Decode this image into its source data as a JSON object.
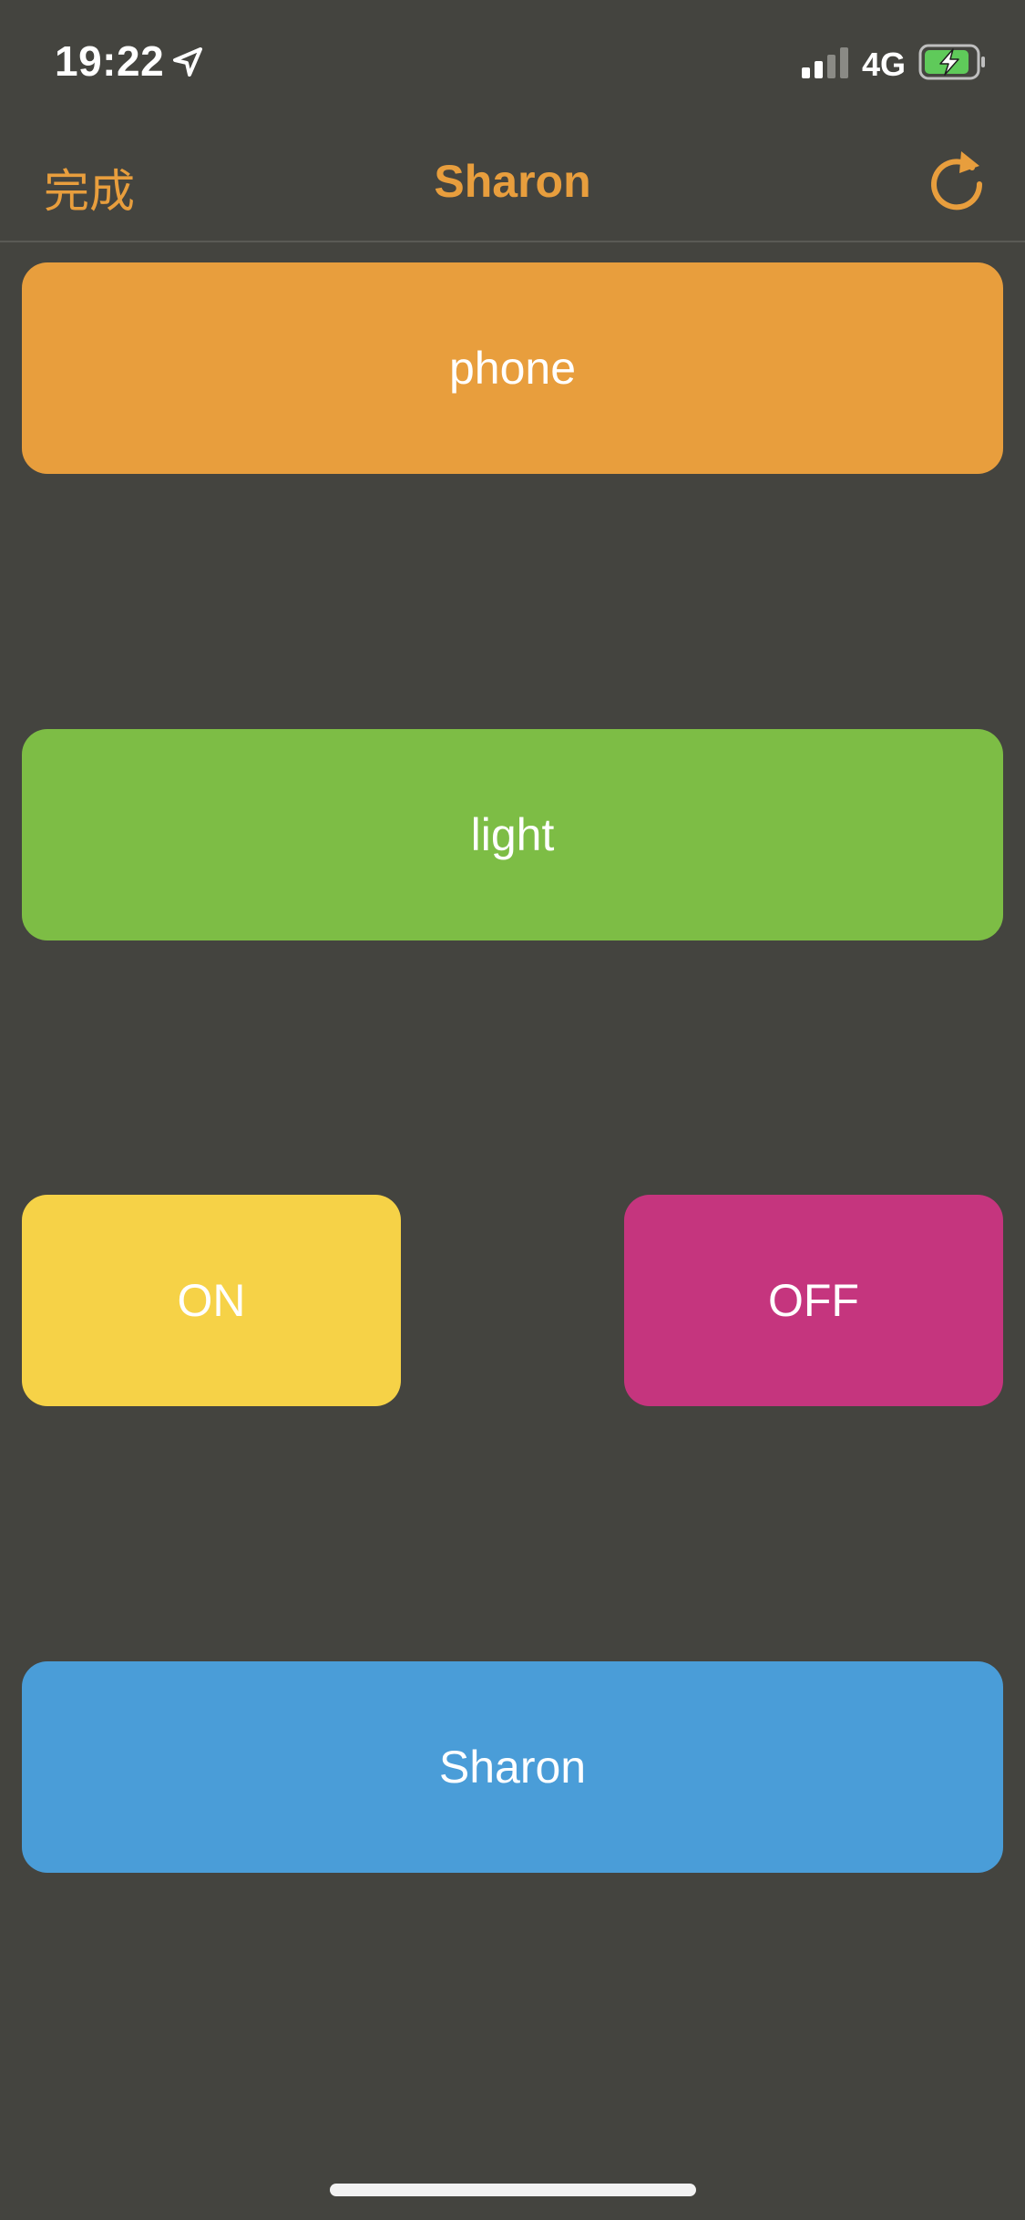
{
  "status_bar": {
    "time": "19:22",
    "network": "4G",
    "icons": [
      "location-arrow-icon",
      "cellular-signal-icon",
      "battery-charging-icon"
    ]
  },
  "nav": {
    "done_label": "完成",
    "title": "Sharon",
    "refresh_icon": "refresh-icon",
    "accent_color": "#e89e3d"
  },
  "buttons": {
    "phone": {
      "label": "phone",
      "color": "#e89e3d"
    },
    "light": {
      "label": "light",
      "color": "#7dbd45"
    },
    "on": {
      "label": "ON",
      "color": "#f6d247"
    },
    "off": {
      "label": "OFF",
      "color": "#c5357e"
    },
    "sharon": {
      "label": "Sharon",
      "color": "#4a9dd8"
    }
  },
  "background_color": "#44443f"
}
